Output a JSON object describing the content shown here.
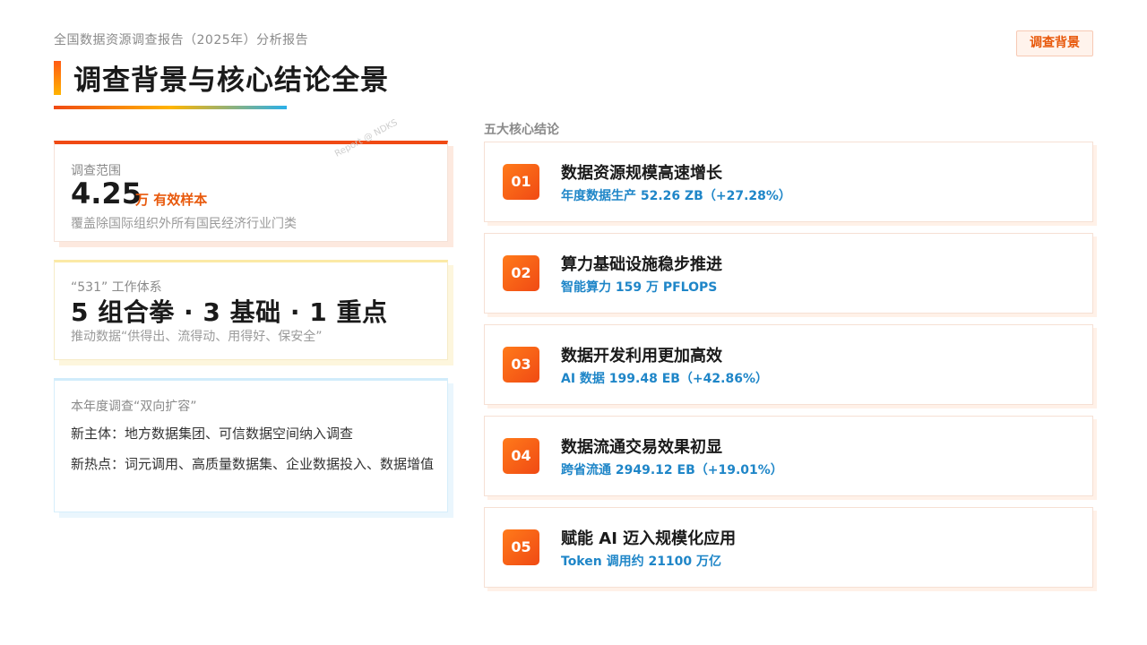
{
  "header": {
    "subtitle": "全国数据资源调查报告（2025年）分析报告",
    "tag": "调查背景",
    "title": "调查背景与核心结论全景"
  },
  "watermark": "Report @ NDKS",
  "left": {
    "card1": {
      "label": "调查范围",
      "number": "4.25",
      "unit": "万 有效样本",
      "desc": "覆盖除国际组织外所有国民经济行业门类"
    },
    "card2": {
      "label": "“531” 工作体系",
      "headline": "5 组合拳 · 3 基础 · 1 重点",
      "desc": "推动数据“供得出、流得动、用得好、保安全”"
    },
    "card3": {
      "label": "本年度调查“双向扩容”",
      "line1": "新主体：地方数据集团、可信数据空间纳入调查",
      "line2": "新热点：词元调用、高质量数据集、企业数据投入、数据增值"
    }
  },
  "right": {
    "section_label": "五大核心结论",
    "items": [
      {
        "num": "01",
        "title": "数据资源规模高速增长",
        "sub": "年度数据生产 52.26 ZB（+27.28%）"
      },
      {
        "num": "02",
        "title": "算力基础设施稳步推进",
        "sub": "智能算力 159 万 PFLOPS"
      },
      {
        "num": "03",
        "title": "数据开发利用更加高效",
        "sub": "AI 数据 199.48 EB（+42.86%）"
      },
      {
        "num": "04",
        "title": "数据流通交易效果初显",
        "sub": "跨省流通 2949.12 EB（+19.01%）"
      },
      {
        "num": "05",
        "title": "赋能 AI 迈入规模化应用",
        "sub": "Token 调用约 21100 万亿"
      }
    ]
  },
  "colors": {
    "accent": "#e8590c",
    "blue": "#1f86c8"
  }
}
